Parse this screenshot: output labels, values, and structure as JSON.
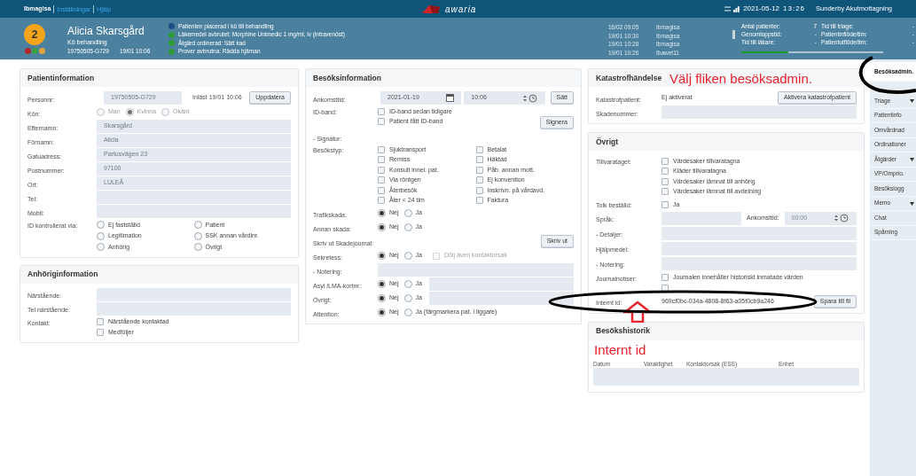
{
  "top_bar": {
    "user": "Ibmagisa",
    "links": [
      "Inställningar",
      "Hjälp"
    ],
    "logo": "awaria",
    "date": "2021-05-12",
    "time": "13:26",
    "unit": "Sunderby Akutmottagning"
  },
  "patient": {
    "priority": "2",
    "name": "Alicia Skarsgård",
    "status": "Kö behandling",
    "personnr": "19750505-G729",
    "time": "19/01 10:06",
    "flags": [
      {
        "color": "#b3262b"
      },
      {
        "color": "#3aa347"
      },
      {
        "color": "#e3a240"
      }
    ]
  },
  "events": [
    {
      "text": "Patienten placerad i kö till behandling",
      "color": "#1d4f86"
    },
    {
      "text": "Läkemedel avbrutet: Morphine Unimedic 1 mg/ml, iv (intravenöst)",
      "color": "#2f9a3a"
    },
    {
      "text": "Åtgärd ordinerad: Sätt kad",
      "color": "#2f9a3a"
    },
    {
      "text": "Prover avbrutna: Rädda hjärnan",
      "color": "#2f9a3a"
    }
  ],
  "log": [
    {
      "time": "16/02 09:05",
      "user": "Ibmagisa"
    },
    {
      "time": "19/01 10:30",
      "user": "Ibmagisa"
    },
    {
      "time": "19/01 10:28",
      "user": "Ibmagisa"
    },
    {
      "time": "19/01 10:26",
      "user": "Ibawet11"
    }
  ],
  "stats": [
    {
      "label": "Antal patienter:",
      "value": "7"
    },
    {
      "label": "Genomloppstid:",
      "value": "-"
    },
    {
      "label": "Tid till läkare:",
      "value": "-"
    }
  ],
  "stats_2": [
    {
      "label": "Tid till triage:",
      "value": "-"
    },
    {
      "label": "Patientinflöde/tim:",
      "value": "-"
    },
    {
      "label": "Patientutflöde/tim:",
      "value": "-"
    }
  ],
  "load": {
    "level": 0.33
  },
  "patient_info": {
    "title": "Patientinformation",
    "rows": [
      {
        "kind": "field_note_button",
        "label": "Personnr:",
        "value": "19750505-G729",
        "note": "Inläst 19/01 10:06",
        "button": "Uppdatera"
      },
      {
        "kind": "radio",
        "label": "Kön:",
        "disabled": true,
        "options": [
          {
            "label": "Man",
            "selected": false
          },
          {
            "label": "Kvinna",
            "selected": true
          },
          {
            "label": "Okänt",
            "selected": false
          }
        ]
      },
      {
        "kind": "field",
        "label": "Efternamn:",
        "value": "Skarsgård"
      },
      {
        "kind": "field",
        "label": "Förnamn:",
        "value": "Alicia"
      },
      {
        "kind": "field",
        "label": "Gatuadress:",
        "value": "Partusvägen 23"
      },
      {
        "kind": "field",
        "label": "Postnummer:",
        "value": "97100"
      },
      {
        "kind": "field",
        "label": "Ort:",
        "value": "LULEÅ"
      },
      {
        "kind": "field",
        "label": "Tel:"
      },
      {
        "kind": "field",
        "label": "Mobil:"
      },
      {
        "kind": "radiogrid",
        "label": "ID kontrollerat via:",
        "options": [
          {
            "label": "Ej fastställd",
            "selected": false
          },
          {
            "label": "Patient",
            "selected": false
          },
          {
            "label": "Legitimation",
            "selected": false
          },
          {
            "label": "SSK annan vårdinr.",
            "selected": false
          },
          {
            "label": "Anhörig",
            "selected": false
          },
          {
            "label": "Övrigt",
            "selected": false
          }
        ]
      }
    ]
  },
  "relatives": {
    "title": "Anhöriginformation",
    "rows": [
      {
        "kind": "field",
        "label": "Närstående:"
      },
      {
        "kind": "field",
        "label": "Tel närstående:"
      },
      {
        "kind": "checks",
        "label": "Kontakt:",
        "options": [
          {
            "label": "Närstående kontaktad",
            "checked": false
          },
          {
            "label": "Medföljer",
            "checked": false
          }
        ]
      }
    ]
  },
  "visit": {
    "title": "Besöksinformation",
    "rows": [
      {
        "kind": "datetime",
        "label": "Ankomsttid:",
        "date": "2021-01-19",
        "time": "10:06",
        "button": "Sätt"
      },
      {
        "kind": "checks",
        "label": "ID-band:",
        "options": [
          {
            "label": "ID-band sedan tidigare",
            "checked": false
          },
          {
            "label": "Patient fått ID-band",
            "checked": false
          }
        ],
        "button": "Signera"
      },
      {
        "kind": "text",
        "label": "- Signatur:"
      },
      {
        "kind": "checkgrid",
        "label": "Besökstyp:",
        "options": [
          {
            "label": "Sjuktransport",
            "checked": false
          },
          {
            "label": "Betalat",
            "checked": false
          },
          {
            "label": "Remiss",
            "checked": false
          },
          {
            "label": "Häktad",
            "checked": false
          },
          {
            "label": "Konsult innel. pat.",
            "checked": false
          },
          {
            "label": "Påb. annan mott.",
            "checked": false
          },
          {
            "label": "Via röntgen",
            "checked": false
          },
          {
            "label": "Ej konvention",
            "checked": false
          },
          {
            "label": "Återbesök",
            "checked": false
          },
          {
            "label": "Inskrivn. på vårdavd.",
            "checked": false
          },
          {
            "label": "Åter < 24 tim",
            "checked": false
          },
          {
            "label": "Faktura",
            "checked": false
          }
        ]
      },
      {
        "kind": "radio",
        "label": "Trafikskada:",
        "options": [
          {
            "label": "Nej",
            "selected": true
          },
          {
            "label": "Ja",
            "selected": false
          }
        ]
      },
      {
        "kind": "radio",
        "label": "Annan skada:",
        "options": [
          {
            "label": "Nej",
            "selected": true
          },
          {
            "label": "Ja",
            "selected": false
          }
        ]
      },
      {
        "kind": "button_row",
        "label": "Skriv ut Skadejournal:",
        "button": "Skriv ut"
      },
      {
        "kind": "radio",
        "label": "Sekretess:",
        "options": [
          {
            "label": "Nej",
            "selected": true
          },
          {
            "label": "Ja",
            "selected": false
          }
        ],
        "check": {
          "label": "Dölj även kontaktorsak",
          "checked": false,
          "disabled": true
        }
      },
      {
        "kind": "field",
        "label": "- Notering:"
      },
      {
        "kind": "radio",
        "label": "Asyl /LMA-kortnr.:",
        "options": [
          {
            "label": "Nej",
            "selected": true
          },
          {
            "label": "Ja",
            "selected": false
          }
        ],
        "field": true
      },
      {
        "kind": "radio",
        "label": "Övrigt:",
        "options": [
          {
            "label": "Nej",
            "selected": true
          },
          {
            "label": "Ja",
            "selected": false
          }
        ],
        "field": true
      },
      {
        "kind": "radio",
        "label": "Attention:",
        "options": [
          {
            "label": "Nej",
            "selected": true
          },
          {
            "label": "Ja (färgmarkera pat. i liggare)",
            "selected": false
          }
        ]
      }
    ]
  },
  "disaster": {
    "title": "Katastrofhändelse",
    "rows": [
      {
        "kind": "text_value_button",
        "label": "Katastrofpatient:",
        "value": "Ej aktiverat",
        "button": "Aktivera katastrofpatient"
      },
      {
        "kind": "field",
        "label": "Skadenummer:"
      }
    ]
  },
  "other": {
    "title": "Övrigt",
    "rows": [
      {
        "kind": "checks",
        "label": "Tillvarataget:",
        "options": [
          {
            "label": "Värdesaker tillvaratagna",
            "checked": false
          },
          {
            "label": "Kläder tillvaratagna",
            "checked": false
          },
          {
            "label": "Värdesaker lämnat till anhörig",
            "checked": false
          },
          {
            "label": "Värdesaker lämnat till avdelning",
            "checked": false
          }
        ]
      },
      {
        "kind": "checks",
        "label": "Tolk beställd:",
        "options": [
          {
            "label": "Ja",
            "checked": false
          }
        ]
      },
      {
        "kind": "field_time",
        "label": "Språk:",
        "time_label": "Ankomsttid:",
        "time_placeholder": "00:00"
      },
      {
        "kind": "field",
        "label": "- Detaljer:"
      },
      {
        "kind": "field",
        "label": "Hjälpmedel:"
      },
      {
        "kind": "field",
        "label": "- Notering:"
      },
      {
        "kind": "checks",
        "label": "Journalnotiser:",
        "options": [
          {
            "label": "Journalen innehåller historiskt inmatade värden",
            "checked": false
          },
          {
            "checked": false
          }
        ]
      },
      {
        "kind": "id_row",
        "label": "Internt id:",
        "value": "969cf0bc-034a-4808-8f63-a05f0cb9a246",
        "button": "Spara till fil"
      }
    ]
  },
  "history": {
    "title": "Besökshistorik",
    "columns": [
      "Datum",
      "Varaktighet",
      "Kontaktorsak (ESS)",
      "Enhet"
    ]
  },
  "sidebar": {
    "items": [
      {
        "label": "Besöksadmin.",
        "selected": true,
        "expandable": false
      },
      {
        "label": "Triage",
        "selected": false,
        "expandable": true
      },
      {
        "label": "Patientinfo",
        "selected": false,
        "expandable": false
      },
      {
        "label": "Omvårdnad",
        "selected": false,
        "expandable": false
      },
      {
        "label": "Ordinationer",
        "selected": false,
        "expandable": false
      },
      {
        "label": "Åtgärder",
        "selected": false,
        "expandable": true
      },
      {
        "label": "VP/Omprio.",
        "selected": false,
        "expandable": false
      },
      {
        "label": "Besökslogg",
        "selected": false,
        "expandable": false
      },
      {
        "label": "Memo",
        "selected": false,
        "expandable": true
      },
      {
        "label": "Chat",
        "selected": false,
        "expandable": false
      },
      {
        "label": "Spårning",
        "selected": false,
        "expandable": false
      }
    ]
  },
  "annotations": [
    {
      "kind": "callout",
      "text": "Välj fliken besöksadmin."
    },
    {
      "kind": "arrow_label",
      "text": "Internt id"
    }
  ]
}
